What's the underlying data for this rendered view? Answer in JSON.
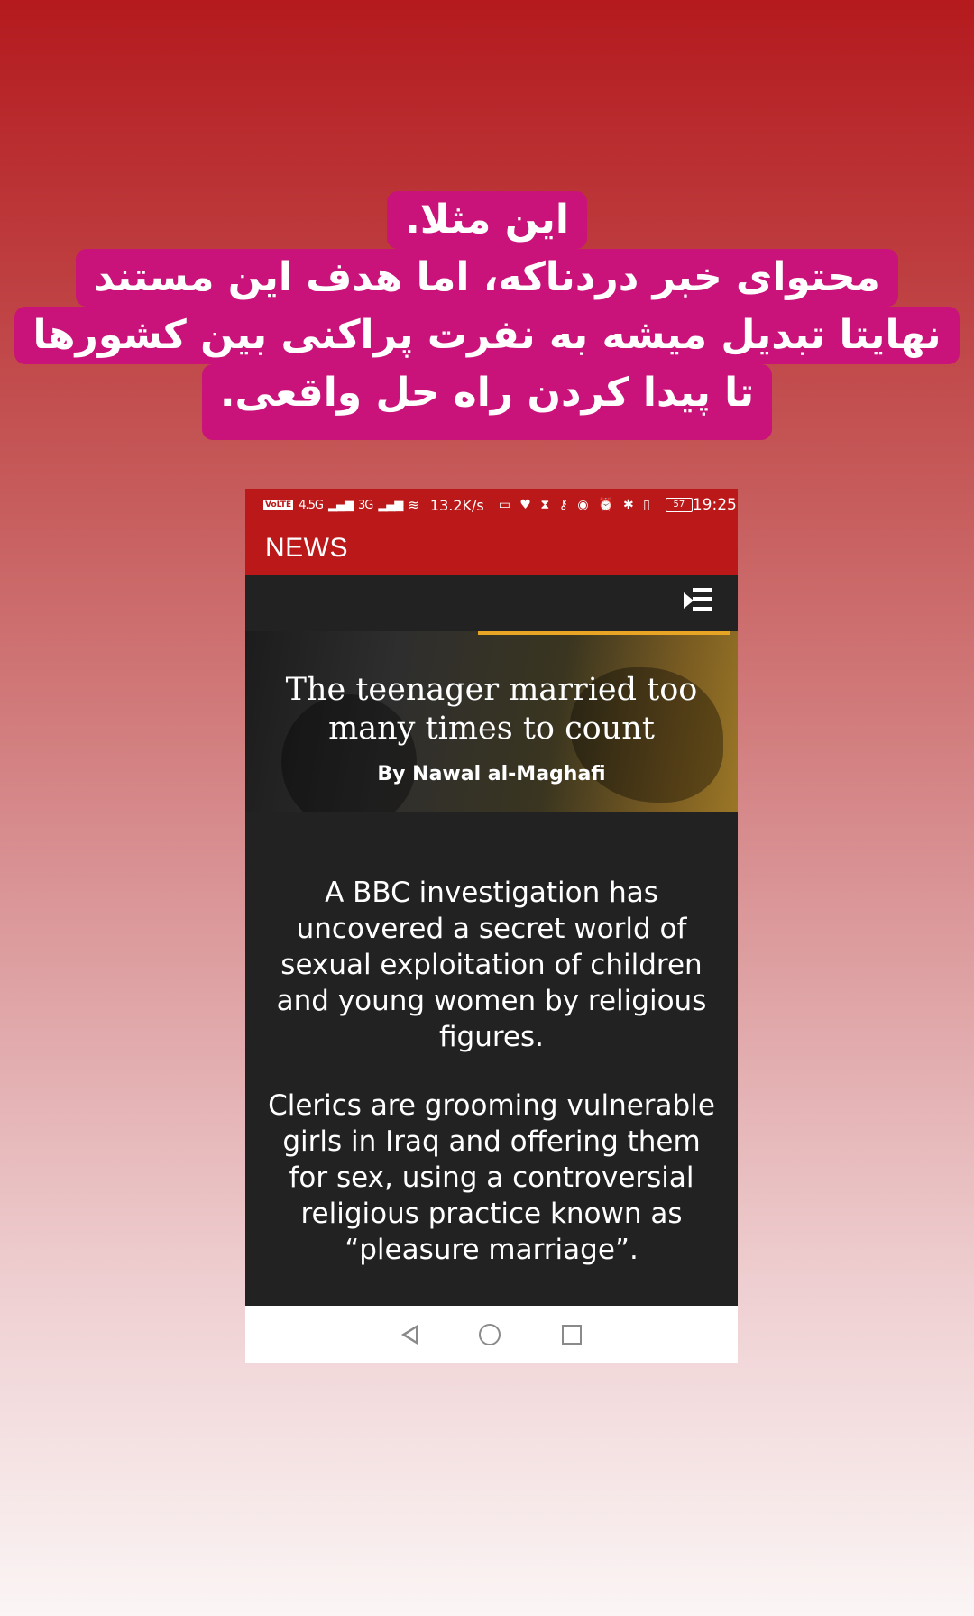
{
  "story_caption": {
    "lines": [
      "این مثلا.",
      "محتوای خبر دردناکه، اما هدف این مستند",
      "نهایتا تبدیل میشه به نفرت پراکنی بین کشورها",
      "تا پیدا کردن راه حل واقعی."
    ],
    "background_color": "#c9137a"
  },
  "status_bar": {
    "volte": "VoLTE",
    "network_4g": "4.5G",
    "network_3g": "3G",
    "speed": "13.2K/s",
    "battery": "57",
    "time": "19:25"
  },
  "app_bar": {
    "title": "NEWS",
    "color": "#bb1919"
  },
  "toolbar": {
    "menu_icon": "menu-icon"
  },
  "article": {
    "headline": "The teenager married too many times to count",
    "byline": "By Nawal al-Maghafi",
    "paragraphs": [
      "A BBC investigation has uncovered a secret world of sexual exploitation of children and young women by religious figures.",
      "Clerics are grooming vulnerable girls in Iraq and offering them for sex, using a controversial religious practice known as “pleasure marriage”."
    ]
  },
  "nav_bar": {
    "back_icon": "back-icon",
    "home_icon": "home-icon",
    "recents_icon": "recents-icon"
  }
}
